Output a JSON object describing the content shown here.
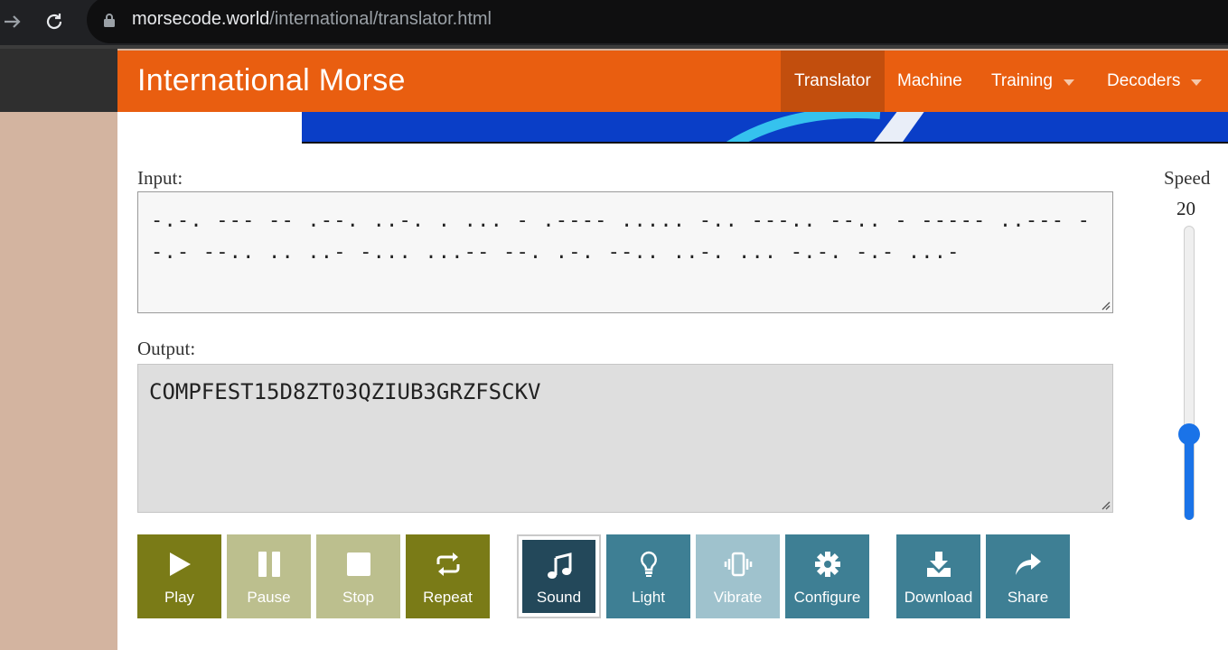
{
  "browser": {
    "url_host": "morsecode.world",
    "url_path": "/international/translator.html"
  },
  "navbar": {
    "brand": "International Morse",
    "items": [
      {
        "label": "Translator",
        "active": true
      },
      {
        "label": "Machine"
      },
      {
        "label": "Training",
        "dropdown": true
      },
      {
        "label": "Decoders",
        "dropdown": true
      }
    ]
  },
  "input": {
    "label": "Input:",
    "value": "-.-. --- -- .--. ..-. . ... - .---- ..... -.. ---.. --.. - ----- ..--- --.- --.. .. ..- -... ...-- --. .-. --.. ..-. ... -.-. -.- ...-"
  },
  "output": {
    "label": "Output:",
    "value": "COMPFEST15D8ZT03QZIUB3GRZFSCKV"
  },
  "speed": {
    "label": "Speed",
    "value": "20"
  },
  "controls": {
    "play": "Play",
    "pause": "Pause",
    "stop": "Stop",
    "repeat": "Repeat",
    "sound": "Sound",
    "light": "Light",
    "vibrate": "Vibrate",
    "configure": "Configure",
    "download": "Download",
    "share": "Share"
  },
  "colors": {
    "navbar": "#e95e10",
    "olive": "#7a7b17",
    "teal": "#3e7f94",
    "slider": "#1a73e8"
  }
}
